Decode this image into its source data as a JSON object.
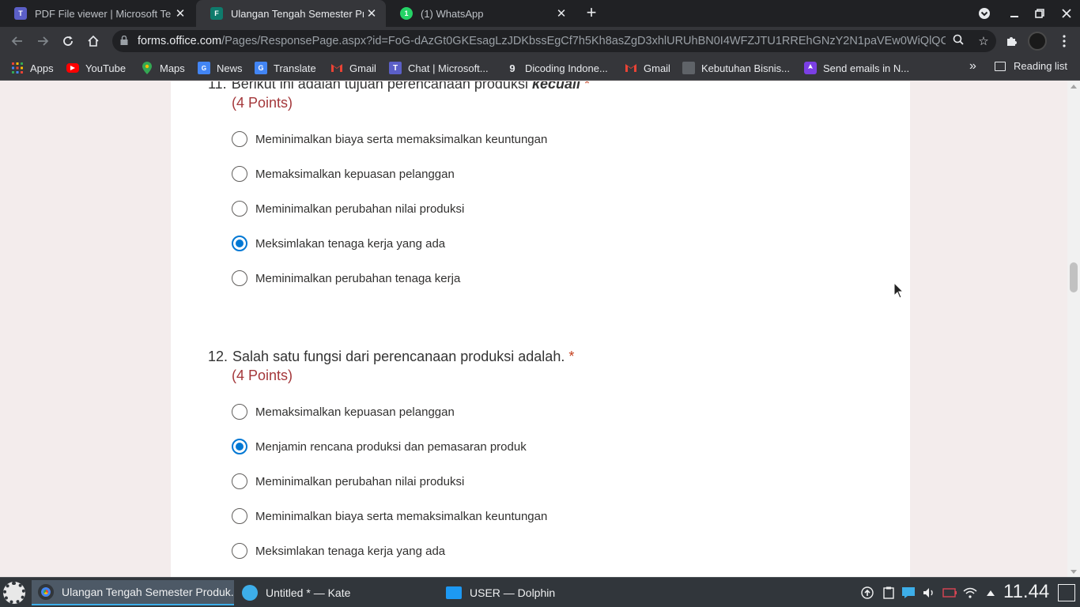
{
  "browser": {
    "tabs": [
      {
        "title": "PDF File viewer | Microsoft Te",
        "icon": "teams-icon",
        "active": false
      },
      {
        "title": "Ulangan Tengah Semester Pr",
        "icon": "forms-icon",
        "active": true
      },
      {
        "title": "(1) WhatsApp",
        "icon": "whatsapp-icon",
        "active": false
      }
    ],
    "url_host": "forms.office.com",
    "url_path": "/Pages/ResponsePage.aspx?id=FoG-dAzGt0GKEsagLzJDKbssEgCf7h5Kh8asZgD3xhlURUhBN0I4WFZJTU1RREhGNzY2N1paVEw0WiQlQC...",
    "bookmarks": [
      {
        "label": "Apps",
        "icon": "apps-grid-icon"
      },
      {
        "label": "YouTube",
        "icon": "youtube-icon"
      },
      {
        "label": "Maps",
        "icon": "maps-icon"
      },
      {
        "label": "News",
        "icon": "news-icon"
      },
      {
        "label": "Translate",
        "icon": "translate-icon"
      },
      {
        "label": "Gmail",
        "icon": "gmail-icon"
      },
      {
        "label": "Chat | Microsoft...",
        "icon": "teams-icon"
      },
      {
        "label": "Dicoding Indone...",
        "icon": "dicoding-icon"
      },
      {
        "label": "Gmail",
        "icon": "gmail-icon"
      },
      {
        "label": "Kebutuhan Bisnis...",
        "icon": "bookmark-page-icon"
      },
      {
        "label": "Send emails in N...",
        "icon": "rocket-icon"
      }
    ],
    "more_bookmarks": "»",
    "reading_list": "Reading list"
  },
  "form": {
    "questions": [
      {
        "number": "11.",
        "text": "Berikut ini adalah tujuan perencanaan produksi ",
        "emphasis": "kecuali",
        "required": "*",
        "points": "(4 Points)",
        "options": [
          {
            "label": "Meminimalkan biaya serta memaksimalkan keuntungan",
            "checked": false
          },
          {
            "label": "Memaksimalkan kepuasan pelanggan",
            "checked": false
          },
          {
            "label": "Meminimalkan perubahan nilai produksi",
            "checked": false
          },
          {
            "label": "Meksimlakan tenaga kerja yang ada",
            "checked": true
          },
          {
            "label": "Meminimalkan perubahan tenaga kerja",
            "checked": false
          }
        ]
      },
      {
        "number": "12.",
        "text": "Salah satu fungsi dari perencanaan produksi adalah.",
        "emphasis": "",
        "required": "*",
        "points": "(4 Points)",
        "options": [
          {
            "label": "Memaksimalkan kepuasan pelanggan",
            "checked": false
          },
          {
            "label": "Menjamin rencana produksi dan pemasaran produk",
            "checked": true
          },
          {
            "label": "Meminimalkan perubahan nilai produksi",
            "checked": false
          },
          {
            "label": "Meminimalkan biaya serta memaksimalkan keuntungan",
            "checked": false
          },
          {
            "label": "Meksimlakan tenaga kerja yang ada",
            "checked": false
          }
        ]
      }
    ]
  },
  "taskbar": {
    "tasks": [
      {
        "label": "Ulangan Tengah Semester Produk...",
        "icon": "chrome-icon",
        "active": true
      },
      {
        "label": "Untitled * — Kate",
        "icon": "kate-icon",
        "active": false
      },
      {
        "label": "USER — Dolphin",
        "icon": "dolphin-folder-icon",
        "active": false
      }
    ],
    "clock": "11.44"
  },
  "colors": {
    "accent": "#0078d4",
    "points_red": "#a4373a",
    "required_red": "#c43e1c",
    "page_bg": "#f3ecec",
    "chrome_dark": "#35363a"
  }
}
